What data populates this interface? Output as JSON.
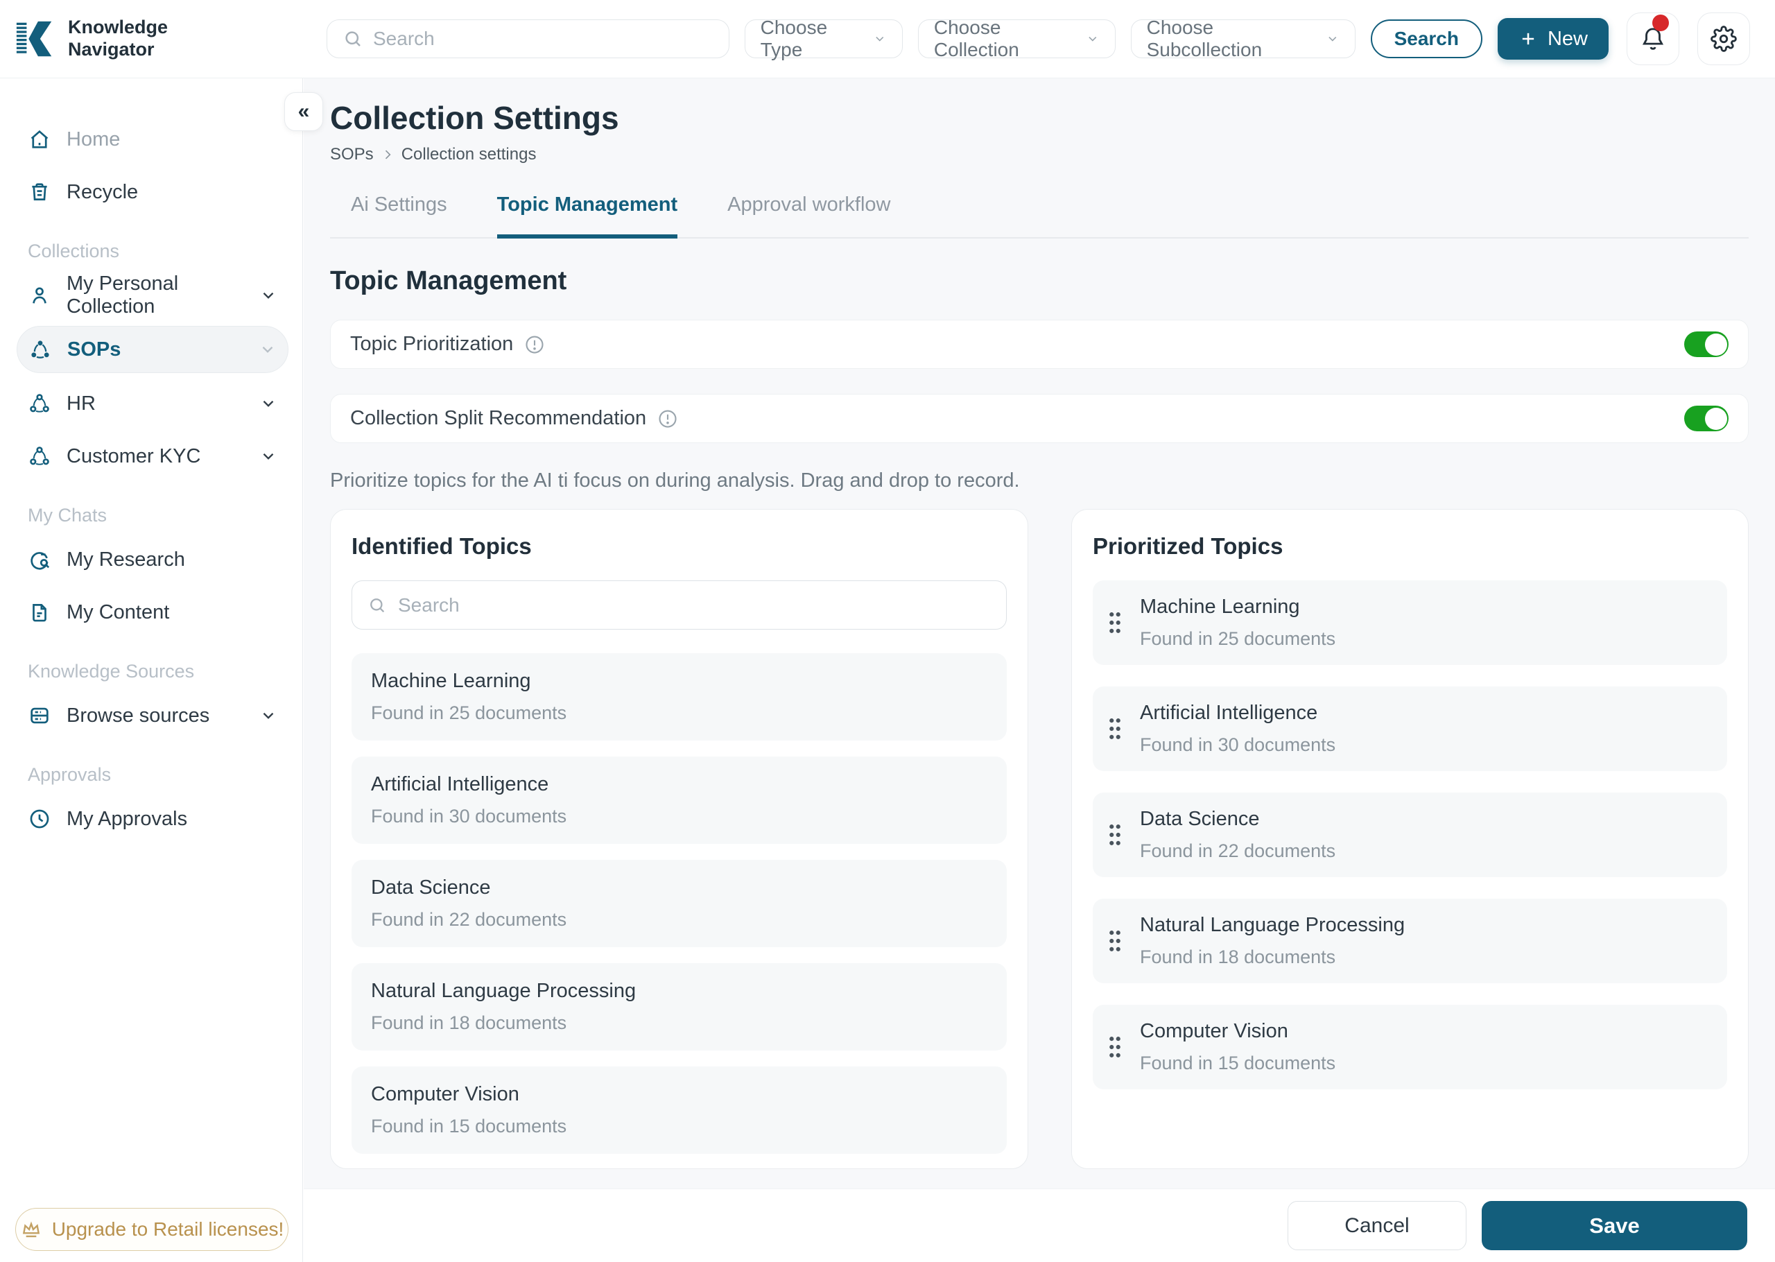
{
  "brand": {
    "line1": "Knowledge",
    "line2": "Navigator"
  },
  "colors": {
    "accent_teal": "#135e7c",
    "toggle_green": "#18a120",
    "notification_red": "#d7282a",
    "upgrade_gold": "#b8914d",
    "content_bg": "#f7f8fa"
  },
  "topbar": {
    "search_placeholder": "Search",
    "choose_type": "Choose Type",
    "choose_collection": "Choose Collection",
    "choose_subcollection": "Choose Subcollection",
    "search_button": "Search",
    "new_button": "New",
    "bell_icon": "bell-icon",
    "gear_icon": "gear-icon"
  },
  "sidebar": {
    "collapse_glyph": "«",
    "top_items": [
      {
        "label": "Home",
        "icon": "home-icon"
      },
      {
        "label": "Recycle",
        "icon": "trash-icon"
      }
    ],
    "sections": [
      {
        "label": "Collections",
        "items": [
          {
            "label": "My Personal Collection",
            "icon": "person-icon",
            "chevron": true
          },
          {
            "label": "SOPs",
            "icon": "network-icon",
            "chevron": true,
            "active": true
          },
          {
            "label": "HR",
            "icon": "people-icon",
            "chevron": true
          },
          {
            "label": "Customer KYC",
            "icon": "people-icon",
            "chevron": true
          }
        ]
      },
      {
        "label": "My Chats",
        "items": [
          {
            "label": "My Research",
            "icon": "research-icon"
          },
          {
            "label": "My Content",
            "icon": "document-icon"
          }
        ]
      },
      {
        "label": "Knowledge Sources",
        "items": [
          {
            "label": "Browse sources",
            "icon": "database-icon",
            "chevron": true
          }
        ]
      },
      {
        "label": "Approvals",
        "items": [
          {
            "label": "My Approvals",
            "icon": "clock-icon"
          }
        ]
      }
    ],
    "upgrade_label": "Upgrade to Retail licenses!"
  },
  "page": {
    "title": "Collection Settings",
    "breadcrumb": [
      "SOPs",
      "Collection settings"
    ],
    "tabs": [
      {
        "label": "Ai Settings",
        "active": false
      },
      {
        "label": "Topic Management",
        "active": true
      },
      {
        "label": "Approval workflow",
        "active": false
      }
    ],
    "section_title": "Topic Management",
    "toggles": [
      {
        "label": "Topic Prioritization",
        "state": "on"
      },
      {
        "label": "Collection Split Recommendation",
        "state": "on"
      }
    ],
    "description": "Prioritize topics for the AI ti focus on during analysis. Drag and drop to record.",
    "identified": {
      "title": "Identified Topics",
      "search_placeholder": "Search",
      "items": [
        {
          "name": "Machine Learning",
          "meta": "Found in 25 documents"
        },
        {
          "name": "Artificial Intelligence",
          "meta": "Found in 30 documents"
        },
        {
          "name": "Data Science",
          "meta": "Found in 22 documents"
        },
        {
          "name": "Natural Language Processing",
          "meta": "Found in 18 documents"
        },
        {
          "name": "Computer Vision",
          "meta": "Found in 15 documents"
        }
      ]
    },
    "prioritized": {
      "title": "Prioritized Topics",
      "items": [
        {
          "name": "Machine Learning",
          "meta": "Found in 25 documents"
        },
        {
          "name": "Artificial Intelligence",
          "meta": "Found in 30 documents"
        },
        {
          "name": "Data Science",
          "meta": "Found in 22 documents"
        },
        {
          "name": "Natural Language Processing",
          "meta": "Found in 18 documents"
        },
        {
          "name": "Computer Vision",
          "meta": "Found in 15 documents"
        }
      ]
    },
    "footer": {
      "cancel": "Cancel",
      "save": "Save"
    }
  }
}
